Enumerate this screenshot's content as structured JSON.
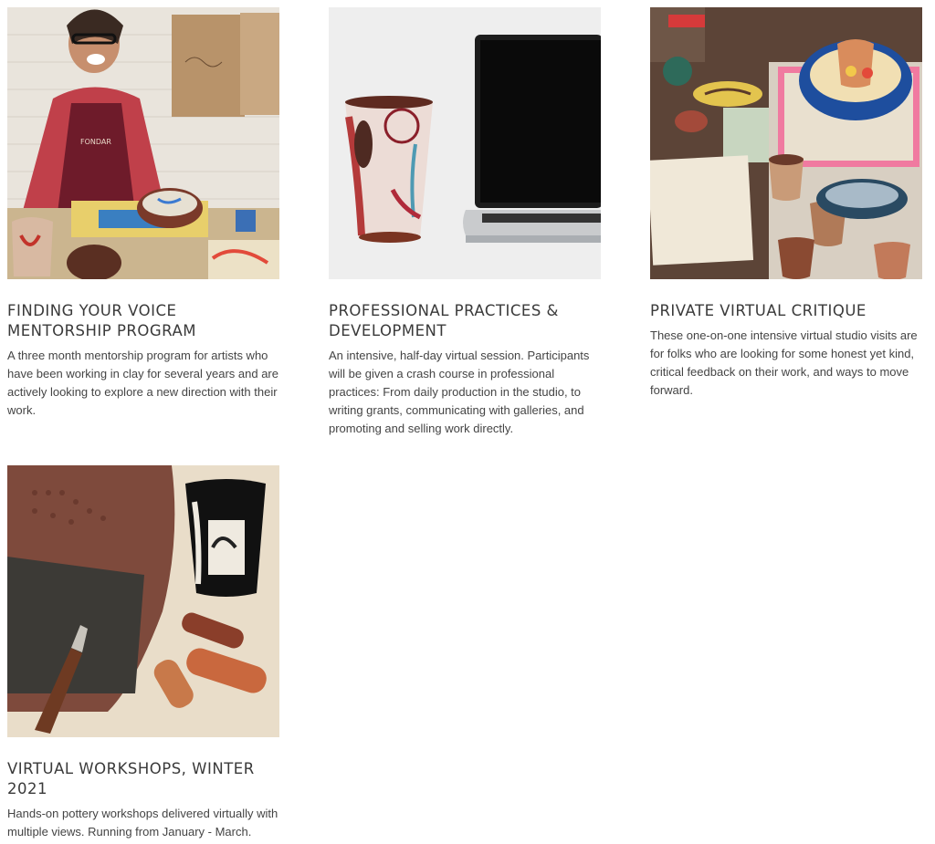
{
  "cards": [
    {
      "title": "FINDING YOUR VOICE MENTORSHIP PROGRAM",
      "description": "A three month mentorship program for artists who have been working in clay for several years and are actively looking to explore a new direction with their work.",
      "apron_text": "FONDAR"
    },
    {
      "title": "PROFESSIONAL PRACTICES & DEVELOPMENT",
      "description": "An intensive, half-day virtual session. Participants will be given a crash course in professional practices: From daily production in the studio, to writing grants, communicating with galleries, and promoting and selling work directly."
    },
    {
      "title": "PRIVATE VIRTUAL CRITIQUE",
      "description": "These one-on-one intensive virtual studio visits are for folks who are looking for some honest yet kind, critical feedback on their work, and ways to move forward."
    },
    {
      "title": "VIRTUAL WORKSHOPS, WINTER 2021",
      "description": "Hands-on pottery workshops delivered virtually with multiple views. Running from January - March."
    }
  ]
}
